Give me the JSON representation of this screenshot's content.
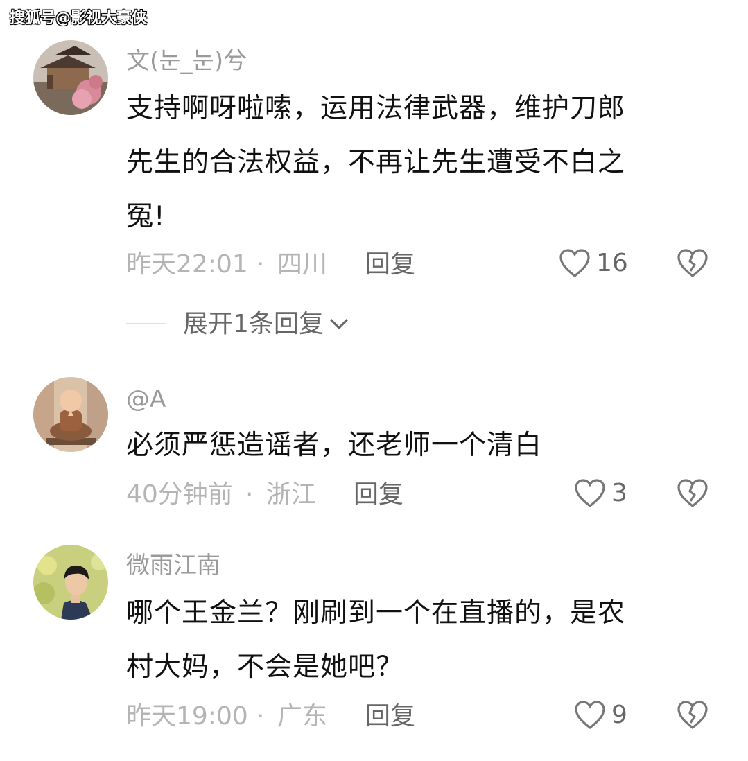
{
  "watermark": "搜狐号@影视大豪侠",
  "comments": [
    {
      "username": "文(눈_눈)兮",
      "lines": [
        "支持啊呀啦嗦，运用法律武器，维护刀郎",
        "先生的合法权益，不再让先生遭受不白之",
        "冤!"
      ],
      "time": "昨天22:01",
      "dot": "·",
      "location": "四川",
      "reply_label": "回复",
      "likes": "16",
      "avatar_icon": "temple-avatar-icon"
    },
    {
      "username": "@A",
      "lines": [
        "必须严惩造谣者，还老师一个清白"
      ],
      "time": "40分钟前",
      "dot": "·",
      "location": "浙江",
      "reply_label": "回复",
      "likes": "3",
      "avatar_icon": "monk-avatar-icon"
    },
    {
      "username": "微雨江南",
      "lines": [
        "哪个王金兰？刚刷到一个在直播的，是农",
        "村大妈，不会是她吧？"
      ],
      "time": "昨天19:00",
      "dot": "·",
      "location": "广东",
      "reply_label": "回复",
      "likes": "9",
      "avatar_icon": "person-avatar-icon"
    }
  ],
  "expand_replies": "展开1条回复",
  "icons": {
    "like": "heart-outline-icon",
    "dislike": "broken-heart-icon",
    "expand": "chevron-down-icon"
  },
  "colors": {
    "username": "#9a9a9a",
    "meta": "#b4b4b4",
    "action": "#666666",
    "text": "#111111"
  }
}
